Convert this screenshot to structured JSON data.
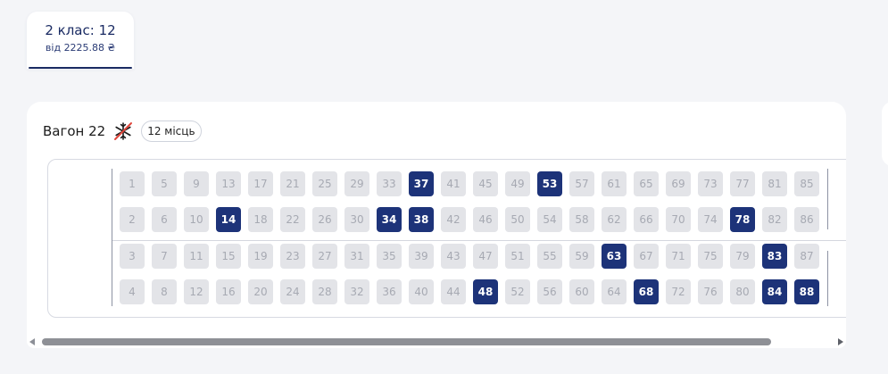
{
  "class_tab": {
    "title": "2 клас: 12",
    "price": "від 2225.88 ₴"
  },
  "wagon": {
    "title": "Вагон 22",
    "feature_icon": "no-air-conditioning-icon",
    "seat_count": "12 місць",
    "rows": [
      [
        "1",
        "5",
        "9",
        "13",
        "17",
        "21",
        "25",
        "29",
        "33",
        "37",
        "41",
        "45",
        "49",
        "53",
        "57",
        "61",
        "65",
        "69",
        "73",
        "77",
        "81",
        "85"
      ],
      [
        "2",
        "6",
        "10",
        "14",
        "18",
        "22",
        "26",
        "30",
        "34",
        "38",
        "42",
        "46",
        "50",
        "54",
        "58",
        "62",
        "66",
        "70",
        "74",
        "78",
        "82",
        "86"
      ],
      [
        "3",
        "7",
        "11",
        "15",
        "19",
        "23",
        "27",
        "31",
        "35",
        "39",
        "43",
        "47",
        "51",
        "55",
        "59",
        "63",
        "67",
        "71",
        "75",
        "79",
        "83",
        "87"
      ],
      [
        "4",
        "8",
        "12",
        "16",
        "20",
        "24",
        "28",
        "32",
        "36",
        "40",
        "44",
        "48",
        "52",
        "56",
        "60",
        "64",
        "68",
        "72",
        "76",
        "80",
        "84",
        "88"
      ]
    ],
    "available_seats": [
      "14",
      "34",
      "37",
      "38",
      "48",
      "53",
      "63",
      "68",
      "78",
      "83",
      "84",
      "88"
    ]
  },
  "colors": {
    "available_seat": "#1d3379",
    "taken_seat": "#e3e4e8",
    "taken_seat_text": "#a7aab3",
    "accent": "#1a2b63"
  }
}
